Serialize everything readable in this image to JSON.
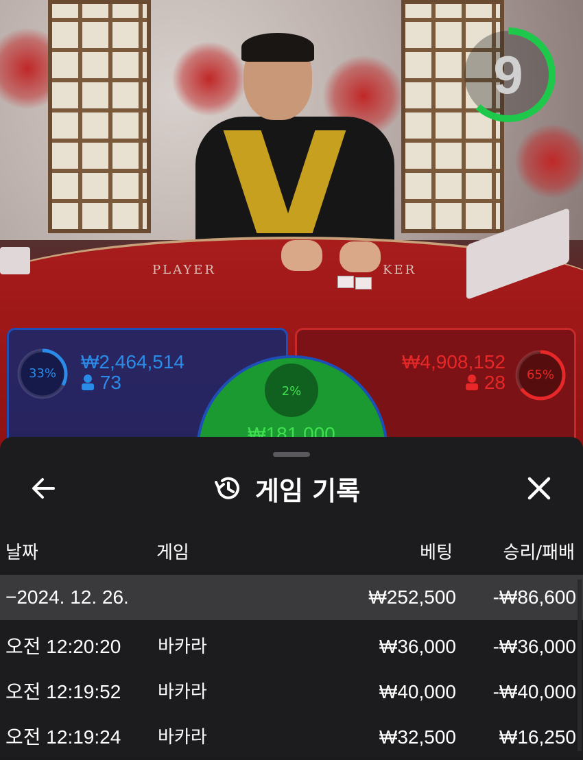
{
  "video": {
    "countdown": "9",
    "countdown_progress": 0.62,
    "felt_player": "PLAYER",
    "felt_banker": "KER"
  },
  "bets": {
    "player": {
      "percent": "33%",
      "percent_value": 0.33,
      "amount": "₩2,464,514",
      "count": "73",
      "color": "#2a8ce8"
    },
    "tie": {
      "percent": "2%",
      "percent_value": 0.02,
      "amount": "₩181,000",
      "color": "#40e050"
    },
    "banker": {
      "percent": "65%",
      "percent_value": 0.65,
      "amount": "₩4,908,152",
      "count": "28",
      "color": "#e82828"
    }
  },
  "sheet": {
    "title": "게임 기록",
    "back_icon": "arrow-left-icon",
    "history_icon": "history-icon",
    "close_icon": "close-icon",
    "columns": [
      "날짜",
      "게임",
      "베팅",
      "승리/패배"
    ],
    "group": {
      "date": "−2024. 12. 26.",
      "bet": "₩252,500",
      "result": "-₩86,600"
    },
    "rows": [
      {
        "time": "오전 12:20:20",
        "game": "바카라",
        "bet": "₩36,000",
        "result": "-₩36,000"
      },
      {
        "time": "오전 12:19:52",
        "game": "바카라",
        "bet": "₩40,000",
        "result": "-₩40,000"
      },
      {
        "time": "오전 12:19:24",
        "game": "바카라",
        "bet": "₩32,500",
        "result": "₩16,250"
      }
    ]
  }
}
